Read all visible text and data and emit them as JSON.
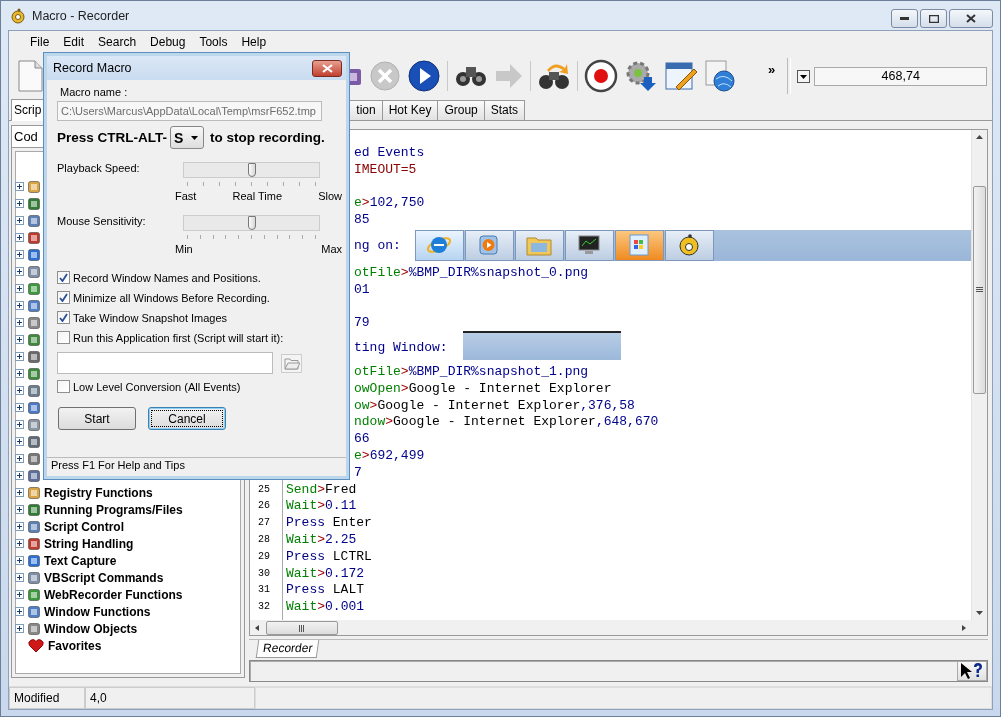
{
  "window": {
    "title": "Macro - Recorder"
  },
  "menu": [
    "File",
    "Edit",
    "Search",
    "Debug",
    "Tools",
    "Help"
  ],
  "toolbar": {
    "overflow": "»",
    "value": "468,74"
  },
  "tabs": [
    {
      "label": "Scrip",
      "selected": true,
      "clipped": false
    },
    {
      "label": "tion",
      "selected": false,
      "clipped": true
    },
    {
      "label": "Hot Key",
      "selected": false,
      "clipped": false
    },
    {
      "label": "Group",
      "selected": false,
      "clipped": false
    },
    {
      "label": "Stats",
      "selected": false,
      "clipped": false
    }
  ],
  "side_tabs": [
    {
      "label": "Cod",
      "selected": true
    }
  ],
  "tree": [
    {
      "expandable": true
    },
    {
      "expandable": true
    },
    {
      "expandable": true
    },
    {
      "expandable": true
    },
    {
      "expandable": true
    },
    {
      "expandable": true
    },
    {
      "expandable": true
    },
    {
      "expandable": true
    },
    {
      "expandable": true
    },
    {
      "expandable": true
    },
    {
      "expandable": true
    },
    {
      "expandable": true
    },
    {
      "expandable": true
    },
    {
      "expandable": true
    },
    {
      "expandable": true
    },
    {
      "expandable": true
    },
    {
      "expandable": true
    },
    {
      "expandable": true
    },
    {
      "label": "Registry Functions",
      "expandable": true
    },
    {
      "label": "Running Programs/Files",
      "expandable": true
    },
    {
      "label": "Script Control",
      "expandable": true
    },
    {
      "label": "String Handling",
      "expandable": true
    },
    {
      "label": "Text Capture",
      "expandable": true
    },
    {
      "label": "VBScript Commands",
      "expandable": true
    },
    {
      "label": "WebRecorder Functions",
      "expandable": true
    },
    {
      "label": "Window Functions",
      "expandable": true
    },
    {
      "label": "Window Objects",
      "expandable": true
    },
    {
      "label": "Favorites",
      "expandable": false
    }
  ],
  "editor": {
    "lines": [
      {
        "clipped": true,
        "segments": [
          {
            "text": "ed Events",
            "kind": "label"
          }
        ]
      },
      {
        "clipped": true,
        "segments": [
          {
            "text": "IMEOUT=5",
            "kind": "setting"
          }
        ]
      },
      {
        "blank": true
      },
      {
        "clipped": true,
        "segments": [
          {
            "text": "e",
            "kind": "command"
          },
          {
            "text": ">",
            "kind": "op"
          },
          {
            "text": "102,750",
            "kind": "value"
          }
        ]
      },
      {
        "clipped": true,
        "segments": [
          {
            "text": "85",
            "kind": "value"
          }
        ]
      },
      {
        "clipped": true,
        "segments": [
          {
            "text": "ng on: ",
            "kind": "label"
          },
          {
            "kind": "taskbar"
          }
        ]
      },
      {
        "clipped": true,
        "segments": [
          {
            "text": "otFile",
            "kind": "command"
          },
          {
            "text": ">",
            "kind": "op"
          },
          {
            "text": "%BMP_DIR%snapshot_0.png",
            "kind": "value"
          }
        ]
      },
      {
        "clipped": true,
        "segments": [
          {
            "text": "01",
            "kind": "value"
          }
        ]
      },
      {
        "blank": true
      },
      {
        "clipped": true,
        "segments": [
          {
            "text": "79",
            "kind": "value"
          }
        ]
      },
      {
        "clipped": true,
        "segments": [
          {
            "text": "ting Window: ",
            "kind": "label"
          },
          {
            "kind": "window"
          }
        ]
      },
      {
        "clipped": true,
        "segments": [
          {
            "text": "otFile",
            "kind": "command"
          },
          {
            "text": ">",
            "kind": "op"
          },
          {
            "text": "%BMP_DIR%snapshot_1.png",
            "kind": "value"
          }
        ]
      },
      {
        "clipped": true,
        "segments": [
          {
            "text": "owOpen",
            "kind": "command"
          },
          {
            "text": ">",
            "kind": "op"
          },
          {
            "text": "Google - Internet Explorer",
            "kind": "text"
          }
        ]
      },
      {
        "clipped": true,
        "segments": [
          {
            "text": "ow",
            "kind": "command"
          },
          {
            "text": ">",
            "kind": "op"
          },
          {
            "text": "Google - Internet Explorer",
            "kind": "text"
          },
          {
            "text": ",376,58",
            "kind": "value"
          }
        ]
      },
      {
        "clipped": true,
        "segments": [
          {
            "text": "ndow",
            "kind": "command"
          },
          {
            "text": ">",
            "kind": "op"
          },
          {
            "text": "Google - Internet Explorer",
            "kind": "text"
          },
          {
            "text": ",648,670",
            "kind": "value"
          }
        ]
      },
      {
        "clipped": true,
        "segments": [
          {
            "text": "66",
            "kind": "value"
          }
        ]
      },
      {
        "clipped": true,
        "segments": [
          {
            "text": "e",
            "kind": "command"
          },
          {
            "text": ">",
            "kind": "op"
          },
          {
            "text": "692,499",
            "kind": "value"
          }
        ]
      },
      {
        "clipped": true,
        "segments": [
          {
            "text": "7",
            "kind": "value"
          }
        ]
      },
      {
        "number": "25",
        "clipped": false,
        "segments": [
          {
            "text": "Send",
            "kind": "command"
          },
          {
            "text": ">",
            "kind": "op"
          },
          {
            "text": "Fred",
            "kind": "text"
          }
        ]
      },
      {
        "number": "26",
        "clipped": false,
        "segments": [
          {
            "text": "Wait",
            "kind": "command"
          },
          {
            "text": ">",
            "kind": "op"
          },
          {
            "text": "0.11",
            "kind": "value"
          }
        ]
      },
      {
        "number": "27",
        "clipped": false,
        "segments": [
          {
            "text": "Press",
            "kind": "keyword"
          },
          {
            "text": " Enter",
            "kind": "text"
          }
        ]
      },
      {
        "number": "28",
        "clipped": false,
        "segments": [
          {
            "text": "Wait",
            "kind": "command"
          },
          {
            "text": ">",
            "kind": "op"
          },
          {
            "text": "2.25",
            "kind": "value"
          }
        ]
      },
      {
        "number": "29",
        "clipped": false,
        "segments": [
          {
            "text": "Press",
            "kind": "keyword"
          },
          {
            "text": " LCTRL",
            "kind": "text"
          }
        ]
      },
      {
        "number": "30",
        "clipped": false,
        "segments": [
          {
            "text": "Wait",
            "kind": "command"
          },
          {
            "text": ">",
            "kind": "op"
          },
          {
            "text": "0.172",
            "kind": "value"
          }
        ]
      },
      {
        "number": "31",
        "clipped": false,
        "segments": [
          {
            "text": "Press",
            "kind": "keyword"
          },
          {
            "text": " LALT",
            "kind": "text"
          }
        ]
      },
      {
        "number": "32",
        "clipped": false,
        "segments": [
          {
            "text": "Wait",
            "kind": "command"
          },
          {
            "text": ">",
            "kind": "op"
          },
          {
            "text": "0.001",
            "kind": "value"
          }
        ]
      }
    ]
  },
  "bottom_tabs": [
    {
      "label": "Recorder",
      "selected": true
    }
  ],
  "status_bar": [
    "Modified",
    "4,0"
  ],
  "dialog": {
    "title": "Record Macro",
    "name_label": "Macro name :",
    "name_value": "C:\\Users\\Marcus\\AppData\\Local\\Temp\\msrF652.tmp",
    "hotkey_prefix": "Press CTRL-ALT-",
    "hotkey": "S",
    "hotkey_suffix": "to stop recording.",
    "sliders": [
      {
        "label": "Playback Speed:",
        "level": 0.5,
        "scale": [
          "Fast",
          "Real Time",
          "Slow"
        ]
      },
      {
        "label": "Mouse Sensitivity:",
        "level": 0.5,
        "scale": [
          "Min",
          "Max"
        ]
      }
    ],
    "options": [
      {
        "label": "Record Window Names and Positions.",
        "checked": true
      },
      {
        "label": "Minimize all Windows Before Recording.",
        "checked": true
      },
      {
        "label": "Take Window Snapshot Images",
        "checked": true
      },
      {
        "label": "Run this Application first (Script will start it):",
        "checked": false
      }
    ],
    "low_level": {
      "label": "Low Level Conversion (All Events)",
      "checked": false
    },
    "buttons": [
      {
        "label": "Start",
        "focused": false
      },
      {
        "label": "Cancel",
        "focused": true
      }
    ],
    "status": "Press F1 For Help and Tips"
  }
}
